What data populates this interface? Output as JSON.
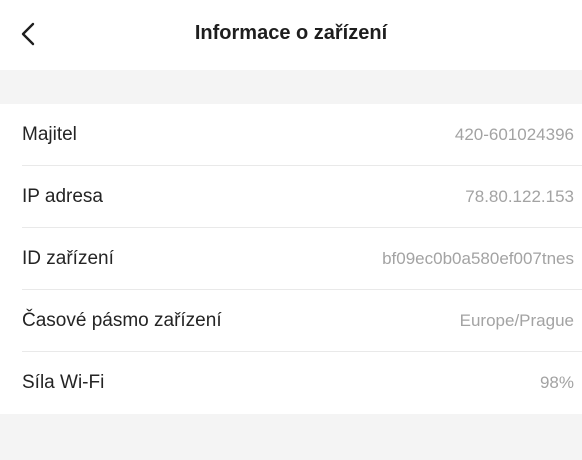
{
  "header": {
    "title": "Informace o zařízení",
    "back_icon": "chevron-left-icon"
  },
  "rows": [
    {
      "label": "Majitel",
      "value": "420-601024396"
    },
    {
      "label": "IP adresa",
      "value": "78.80.122.153"
    },
    {
      "label": "ID zařízení",
      "value": "bf09ec0b0a580ef007tnes"
    },
    {
      "label": "Časové pásmo zařízení",
      "value": "Europe/Prague"
    },
    {
      "label": "Síla Wi-Fi",
      "value": "98%"
    }
  ],
  "colors": {
    "background": "#ffffff",
    "band": "#f4f4f4",
    "label": "#242424",
    "value": "#a3a3a3",
    "divider": "#e9e9e9"
  }
}
